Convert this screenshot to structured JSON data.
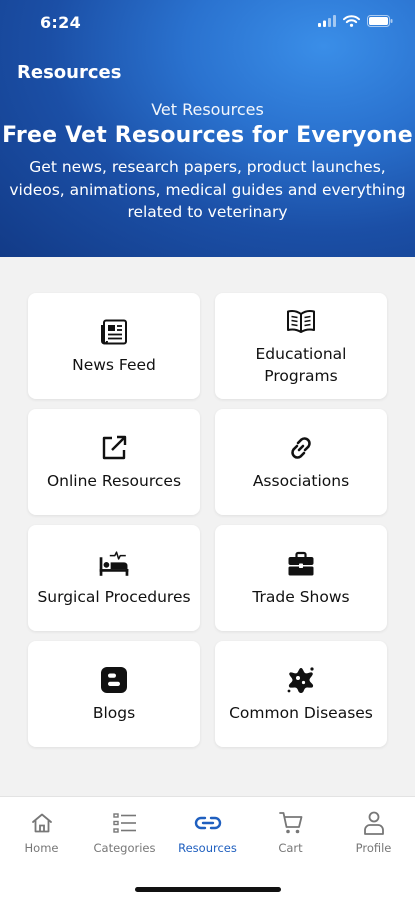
{
  "status_bar": {
    "time": "6:24"
  },
  "header": {
    "title": "Resources"
  },
  "hero": {
    "subtitle": "Vet Resources",
    "title": "Free Vet Resources for Everyone",
    "description": "Get news, research papers, product launches, videos, animations, medical guides and everything related to veterinary"
  },
  "cards": [
    {
      "label": "News Feed",
      "icon": "newspaper-icon"
    },
    {
      "label": "Educational\nPrograms",
      "icon": "book-open-icon"
    },
    {
      "label": "Online Resources",
      "icon": "external-link-icon"
    },
    {
      "label": "Associations",
      "icon": "link-icon"
    },
    {
      "label": "Surgical Procedures",
      "icon": "hospital-bed-icon"
    },
    {
      "label": "Trade Shows",
      "icon": "briefcase-icon"
    },
    {
      "label": "Blogs",
      "icon": "blogger-icon"
    },
    {
      "label": "Common Diseases",
      "icon": "virus-icon"
    }
  ],
  "tabs": [
    {
      "label": "Home",
      "icon": "home-icon",
      "active": false
    },
    {
      "label": "Categories",
      "icon": "list-icon",
      "active": false
    },
    {
      "label": "Resources",
      "icon": "link-icon",
      "active": true
    },
    {
      "label": "Cart",
      "icon": "cart-icon",
      "active": false
    },
    {
      "label": "Profile",
      "icon": "person-icon",
      "active": false
    }
  ],
  "colors": {
    "accent": "#1f5fbf",
    "header_dark": "#123a86",
    "header_light": "#3a8ee8"
  }
}
